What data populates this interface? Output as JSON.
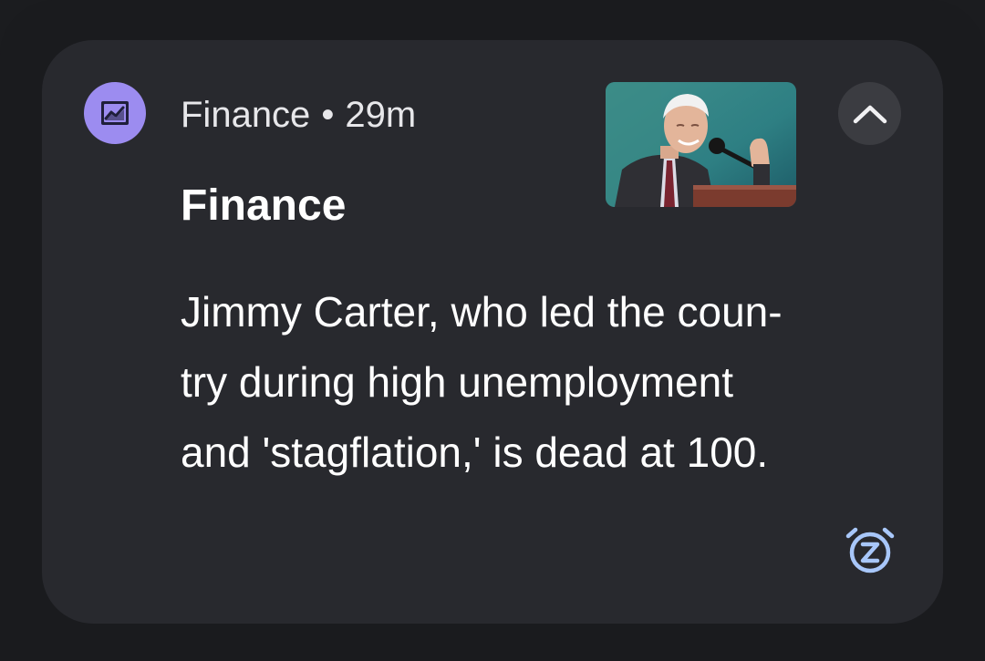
{
  "notification": {
    "app_name": "Finance",
    "separator": "•",
    "time_ago": "29m",
    "title": "Finance",
    "body_lines": [
      "Jimmy Carter, who led the coun-",
      "try during high unemployment",
      "and 'stagflation,' is dead at 100."
    ],
    "app_icon": "finance-chart-icon",
    "expand_icon": "chevron-up-icon",
    "snooze_icon": "snooze-alarm-icon"
  },
  "colors": {
    "background": "#1b1c1f",
    "card": "#28292e",
    "app_icon_bg": "#9c8cf0",
    "snooze_accent": "#a8c7fa",
    "text_primary": "#ffffff",
    "text_secondary": "#e7e7ea"
  }
}
